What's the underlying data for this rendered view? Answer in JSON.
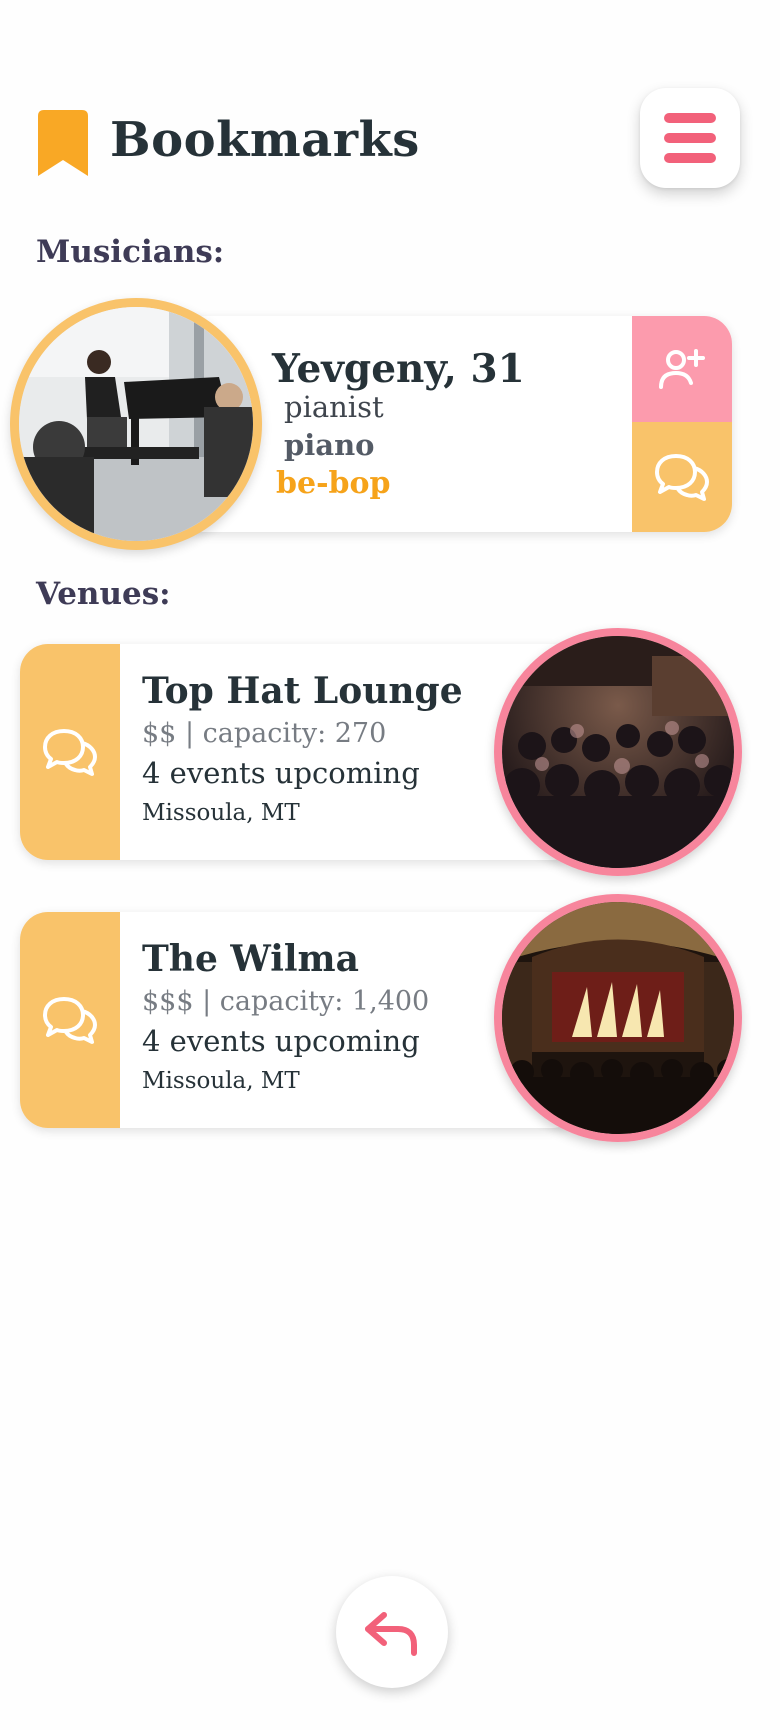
{
  "header": {
    "title": "Bookmarks",
    "accent": "#f9a825",
    "menu_color": "#f2617a"
  },
  "sections": {
    "musicians_label": "Musicians:",
    "venues_label": "Venues:"
  },
  "musicians": [
    {
      "name": "Yevgeny, 31",
      "role": "pianist",
      "instrument": "piano",
      "genre": "be-bop"
    }
  ],
  "venues": [
    {
      "name": "Top Hat Lounge",
      "meta": "$$ | capacity: 270",
      "events": "4 events upcoming",
      "location": "Missoula, MT"
    },
    {
      "name": "The Wilma",
      "meta": "$$$ | capacity: 1,400",
      "events": "4 events upcoming",
      "location": "Missoula, MT"
    }
  ],
  "colors": {
    "musician_ring": "#f9c36a",
    "venue_ring": "#f7859c",
    "chat_bg": "#f9c36a",
    "add_friend_bg": "#fc9bad",
    "genre": "#f6a31a"
  },
  "icons": [
    "bookmark-icon",
    "menu-icon",
    "add-friend-icon",
    "chat-icon",
    "back-arrow-icon"
  ]
}
